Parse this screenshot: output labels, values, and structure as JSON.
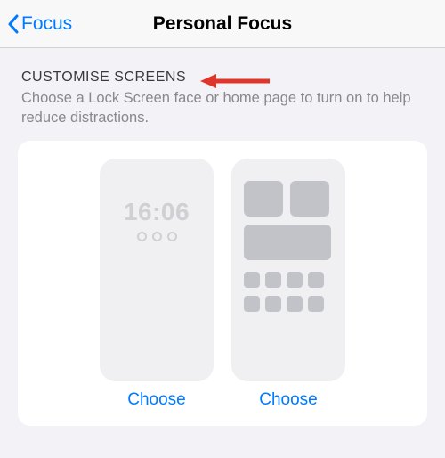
{
  "nav": {
    "back_label": "Focus",
    "title": "Personal Focus"
  },
  "section": {
    "header": "CUSTOMISE SCREENS",
    "description": "Choose a Lock Screen face or home page to turn on to help reduce distractions."
  },
  "lock_preview": {
    "time": "16:06"
  },
  "options": {
    "lock_choose": "Choose",
    "home_choose": "Choose"
  },
  "colors": {
    "accent": "#007aff",
    "annotation": "#e0352b"
  }
}
